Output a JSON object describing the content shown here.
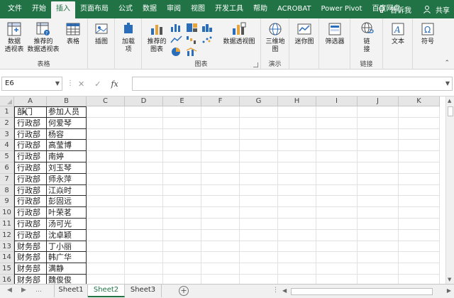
{
  "menu": {
    "items": [
      "文件",
      "开始",
      "插入",
      "页面布局",
      "公式",
      "数据",
      "审阅",
      "视图",
      "开发工具",
      "帮助",
      "ACROBAT",
      "Power Pivot",
      "百度网盘"
    ],
    "active_index": 2,
    "tell_me": "告诉我",
    "share": "共享"
  },
  "ribbon": {
    "tables": {
      "pivot": "数据\n透视表",
      "recommended_pivot": "推荐的\n数据透视表",
      "table": "表格",
      "label": "表格"
    },
    "illustrations": {
      "label": "插图"
    },
    "addins": {
      "label": "加载\n项"
    },
    "charts": {
      "recommended": "推荐的\n图表",
      "pivot_chart": "数据透视图",
      "label": "图表"
    },
    "tours": {
      "map3d": "三维地\n图",
      "label": "演示"
    },
    "sparklines": {
      "label": "迷你图"
    },
    "filters": {
      "label": "筛选器"
    },
    "links": {
      "link": "链\n接",
      "label": "链接"
    },
    "text": {
      "label": "文本"
    },
    "symbols": {
      "label": "符号"
    }
  },
  "formula_bar": {
    "name_box": "E6",
    "fx": "fx",
    "value": ""
  },
  "sheet": {
    "columns": [
      "A",
      "B",
      "C",
      "D",
      "E",
      "F",
      "G",
      "H",
      "I",
      "J",
      "K"
    ],
    "rows": [
      [
        "部门",
        "参加人员"
      ],
      [
        "行政部",
        "何爱琴"
      ],
      [
        "行政部",
        "杨容"
      ],
      [
        "行政部",
        "高莹博"
      ],
      [
        "行政部",
        "南婷"
      ],
      [
        "行政部",
        "刘玉琴"
      ],
      [
        "行政部",
        "师永萍"
      ],
      [
        "行政部",
        "江焱时"
      ],
      [
        "行政部",
        "彭固远"
      ],
      [
        "行政部",
        "叶荣茗"
      ],
      [
        "行政部",
        "汤可光"
      ],
      [
        "行政部",
        "沈卓颖"
      ],
      [
        "财务部",
        "丁小丽"
      ],
      [
        "财务部",
        "韩广华"
      ],
      [
        "财务部",
        "满静"
      ],
      [
        "财务部",
        "魏俊俊"
      ]
    ]
  },
  "tabs": {
    "sheets": [
      "Sheet1",
      "Sheet2",
      "Sheet3"
    ],
    "active_index": 1
  }
}
